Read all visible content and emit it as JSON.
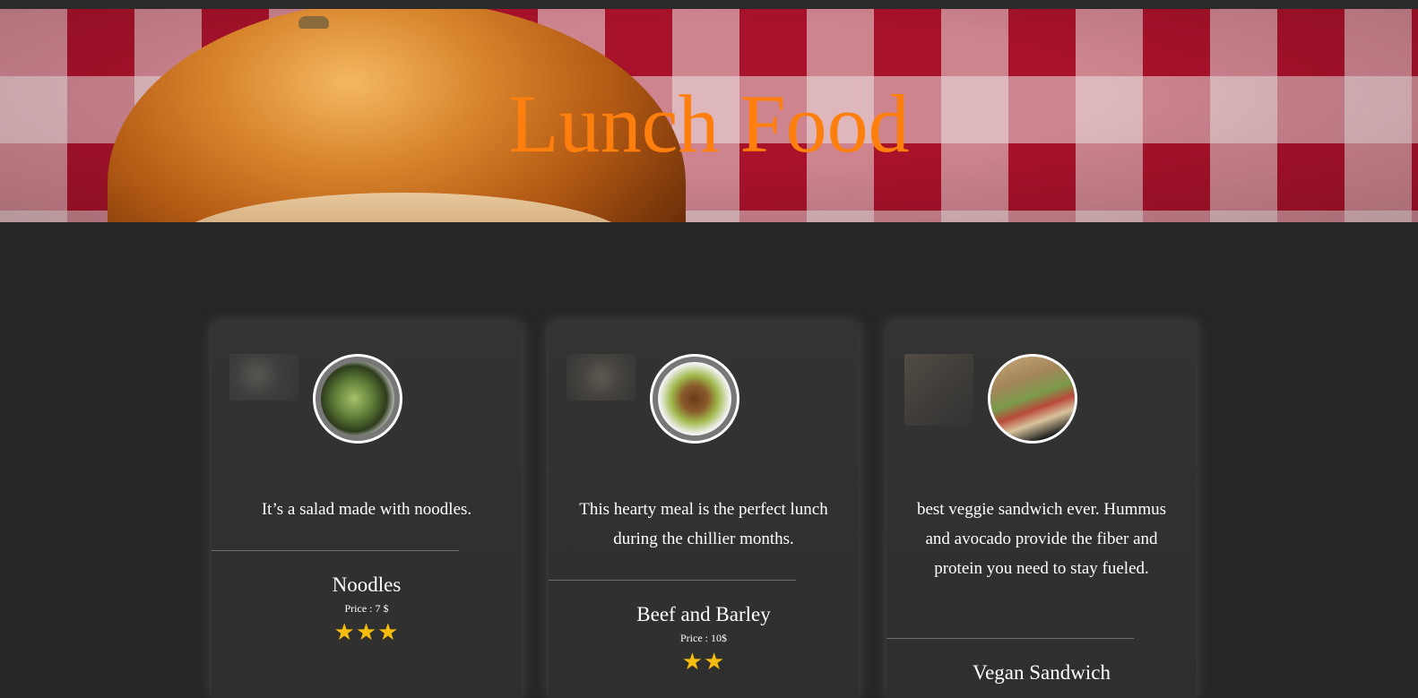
{
  "page": {
    "title": "Lunch Food",
    "accent_color": "#ff7f0e",
    "star_color": "#f6bd0f"
  },
  "hero": {
    "background": "red-white-checkered-tablecloth",
    "image": "burger-bun"
  },
  "cards": [
    {
      "description": "It’s a salad made with noodles.",
      "name": "Noodles",
      "price": "Price : 7 $",
      "rating": 3,
      "thumb_icon": "noodle-salad-thumbnail",
      "avatar_icon": "noodle-salad-photo"
    },
    {
      "description": "This hearty meal is the perfect lunch during the chillier months.",
      "name": "Beef and Barley",
      "price": "Price : 10$",
      "rating": 2,
      "thumb_icon": "beef-barley-thumbnail",
      "avatar_icon": "beef-barley-photo"
    },
    {
      "description": "best veggie sandwich ever. Hummus and avocado provide the fiber and protein you need to stay fueled.",
      "name": "Vegan Sandwich",
      "price": "",
      "rating": 0,
      "thumb_icon": "vegan-sandwich-thumbnail",
      "avatar_icon": "vegan-sandwich-photo"
    }
  ]
}
